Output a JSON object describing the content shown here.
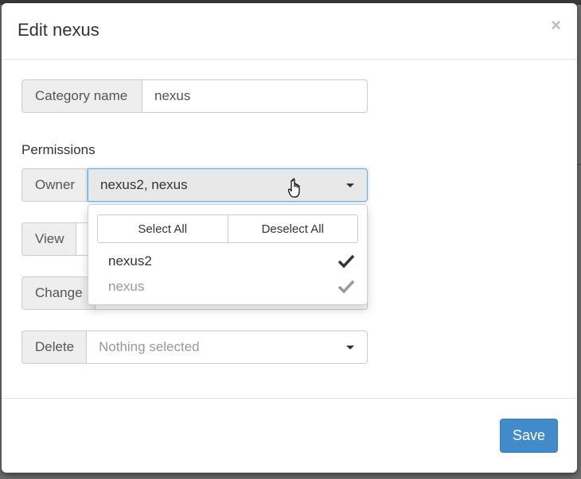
{
  "modal": {
    "title": "Edit nexus",
    "close_label": "×"
  },
  "form": {
    "category_label": "Category name",
    "category_value": "nexus",
    "permissions_label": "Permissions",
    "owner": {
      "label": "Owner",
      "value": "nexus2, nexus"
    },
    "view": {
      "label": "View"
    },
    "change": {
      "label": "Change"
    },
    "delete": {
      "label": "Delete",
      "placeholder": "Nothing selected"
    }
  },
  "dropdown": {
    "select_all": "Select All",
    "deselect_all": "Deselect All",
    "options": [
      {
        "label": "nexus2",
        "selected": true
      },
      {
        "label": "nexus",
        "selected": true,
        "disabled": true
      }
    ]
  },
  "footer": {
    "save_label": "Save"
  },
  "colors": {
    "primary": "#428bca",
    "focus": "#66afe9"
  }
}
